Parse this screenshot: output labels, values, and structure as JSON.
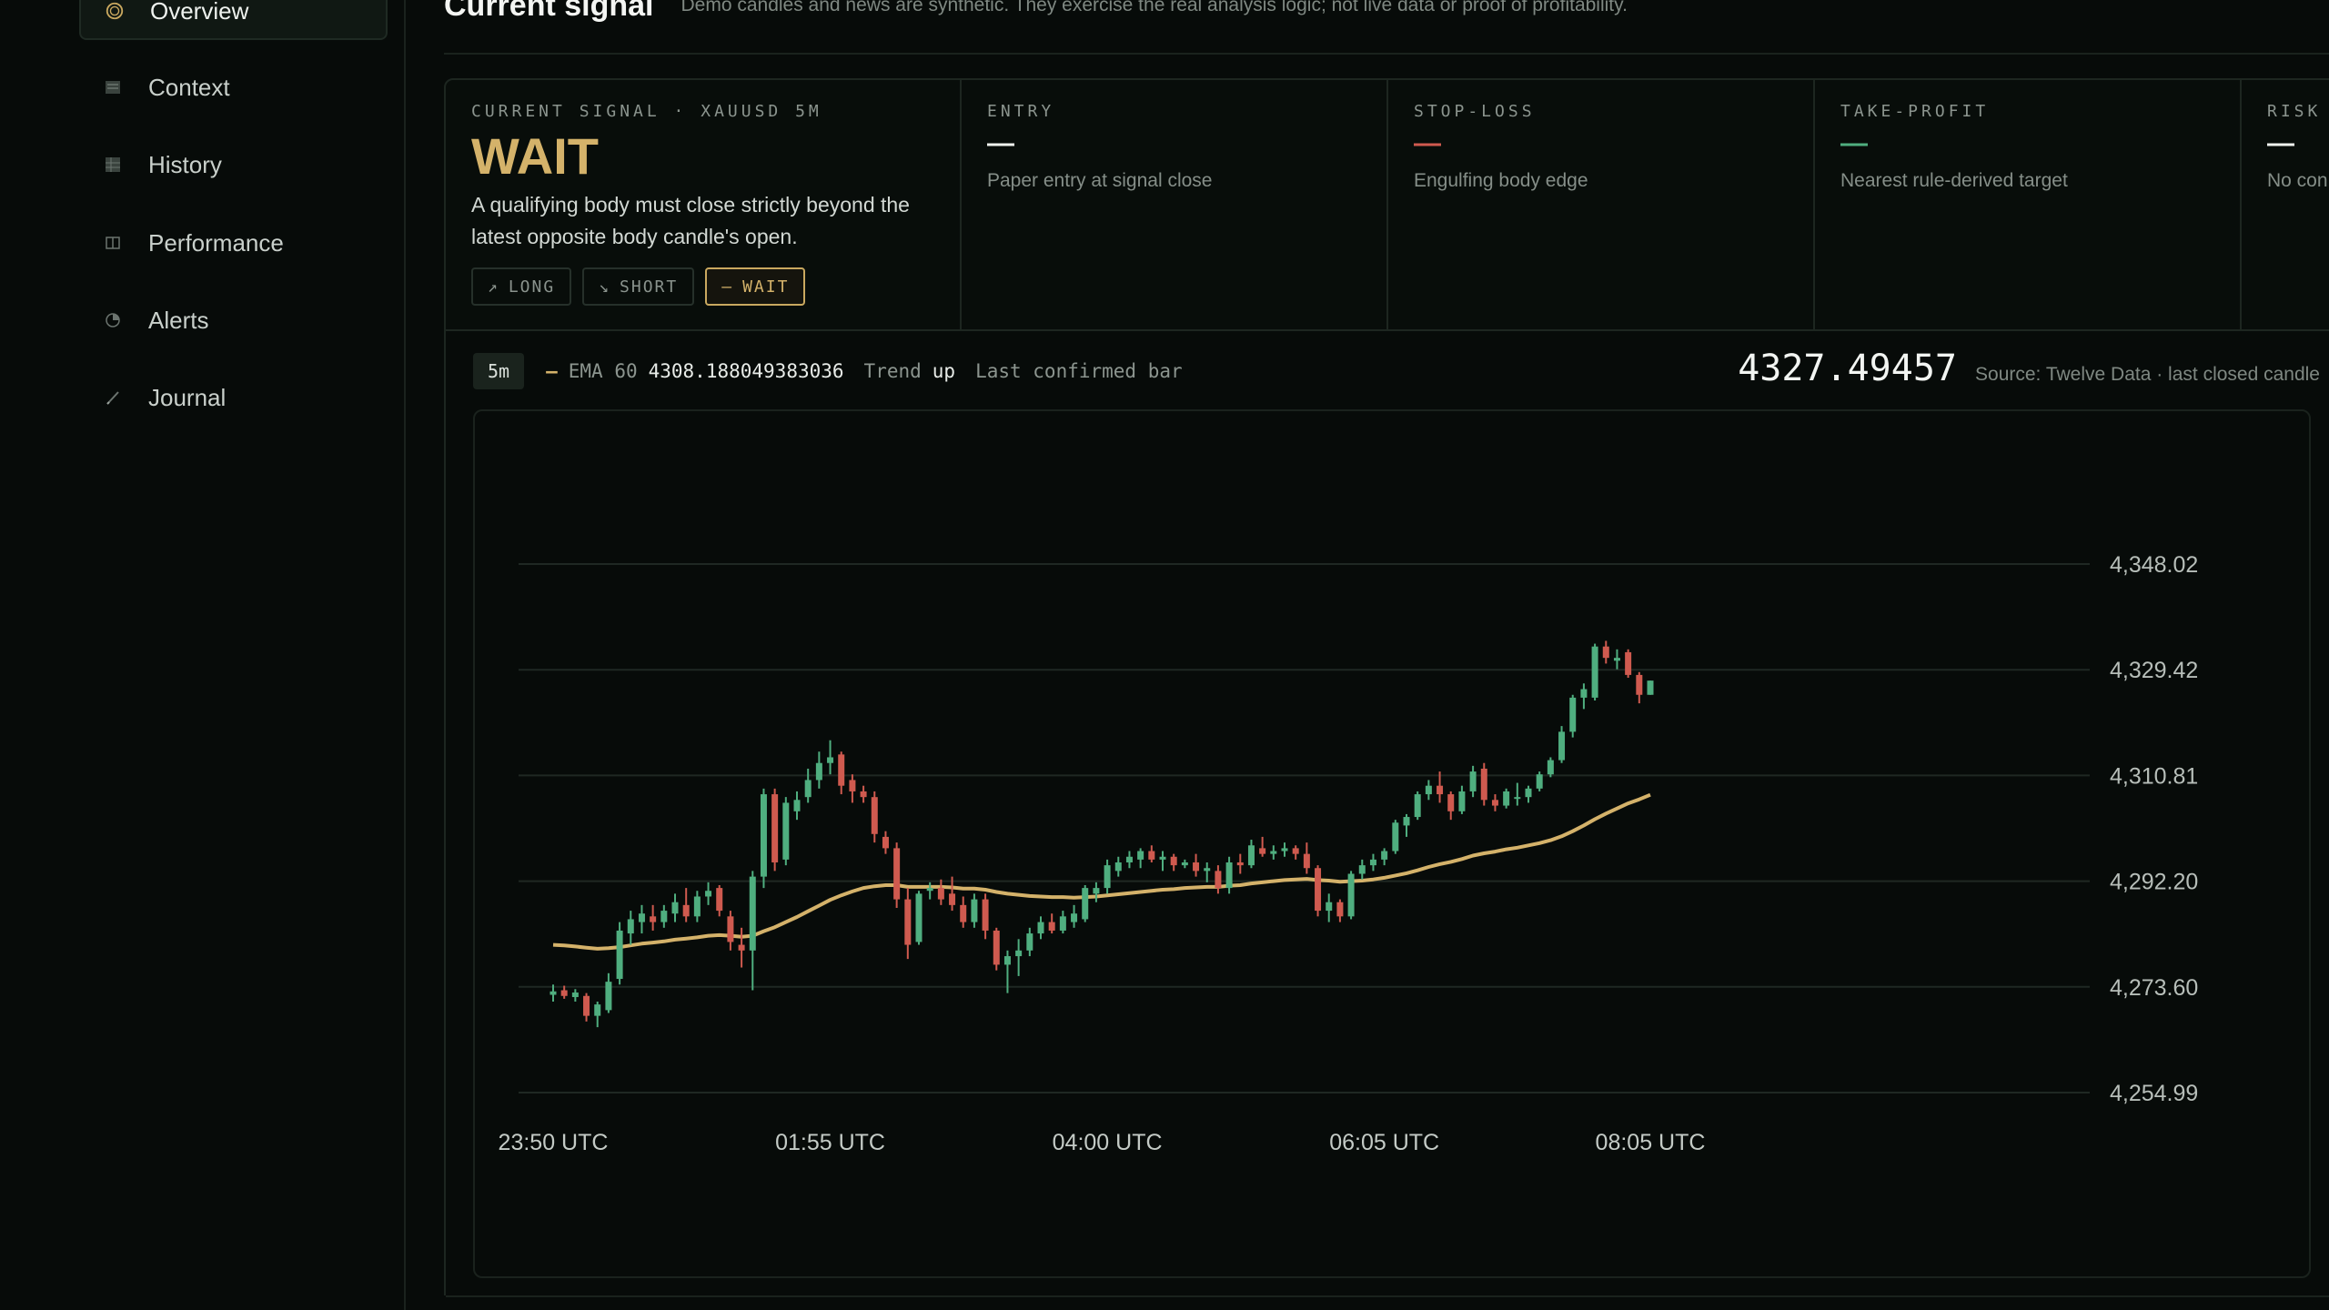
{
  "sidebar": {
    "items": [
      {
        "label": "Overview",
        "icon": "target-icon",
        "active": true
      },
      {
        "label": "Context",
        "icon": "document-icon",
        "active": false
      },
      {
        "label": "History",
        "icon": "grid-icon",
        "active": false
      },
      {
        "label": "Performance",
        "icon": "columns-icon",
        "active": false
      },
      {
        "label": "Alerts",
        "icon": "pie-icon",
        "active": false
      },
      {
        "label": "Journal",
        "icon": "pen-icon",
        "active": false
      }
    ]
  },
  "header": {
    "title": "Current signal",
    "disclaimer": "Demo candles and news are synthetic. They exercise the real analysis logic; not live data or proof of profitability."
  },
  "signal": {
    "label": "CURRENT SIGNAL · XAUUSD 5M",
    "value": "WAIT",
    "description": "A qualifying body must close strictly beyond the latest opposite body candle's open.",
    "buttons": {
      "long": "LONG",
      "short": "SHORT",
      "wait": "WAIT"
    },
    "entry": {
      "label": "ENTRY",
      "value": "—",
      "sub": "Paper entry at signal close"
    },
    "stop_loss": {
      "label": "STOP-LOSS",
      "value": "—",
      "sub": "Engulfing body edge"
    },
    "take_profit": {
      "label": "TAKE-PROFIT",
      "value": "—",
      "sub": "Nearest rule-derived target"
    },
    "risk": {
      "label": "RISK",
      "value": "—",
      "sub": "No con"
    }
  },
  "chart_header": {
    "timeframe": "5m",
    "ema_label": "EMA 60",
    "ema_value": "4308.188049383036",
    "trend_label": "Trend",
    "trend_value": "up",
    "bar_status": "Last confirmed bar",
    "price": "4327.49457",
    "source": "Source: Twelve Data · last closed candle"
  },
  "colors": {
    "up": "#4fae7f",
    "down": "#cf5a4f",
    "ema": "#d4b26a",
    "accent": "#d4b26a"
  },
  "chart_data": {
    "type": "candlestick",
    "y_ticks": [
      "4,348.02",
      "4,329.42",
      "4,310.81",
      "4,292.20",
      "4,273.60",
      "4,254.99"
    ],
    "ylim": [
      4254.99,
      4348.02
    ],
    "x_ticks": [
      "23:50 UTC",
      "01:55 UTC",
      "04:00 UTC",
      "06:05 UTC",
      "08:05 UTC"
    ],
    "x_tick_index": [
      0,
      25,
      50,
      75,
      99
    ],
    "candles": [
      [
        4272.2,
        4274.0,
        4271.0,
        4272.8
      ],
      [
        4273.0,
        4273.8,
        4271.5,
        4272.0
      ],
      [
        4271.8,
        4273.2,
        4271.0,
        4272.6
      ],
      [
        4272.0,
        4272.5,
        4267.5,
        4268.5
      ],
      [
        4268.5,
        4271.0,
        4266.5,
        4270.5
      ],
      [
        4269.5,
        4276.0,
        4269.0,
        4274.5
      ],
      [
        4275.0,
        4285.0,
        4274.0,
        4283.5
      ],
      [
        4283.0,
        4287.0,
        4281.0,
        4285.5
      ],
      [
        4285.0,
        4288.0,
        4283.0,
        4286.5
      ],
      [
        4286.0,
        4288.0,
        4283.5,
        4285.0
      ],
      [
        4285.0,
        4288.0,
        4284.0,
        4287.0
      ],
      [
        4286.5,
        4290.0,
        4285.0,
        4288.5
      ],
      [
        4288.0,
        4291.0,
        4285.0,
        4286.0
      ],
      [
        4286.0,
        4290.5,
        4285.0,
        4289.5
      ],
      [
        4289.5,
        4292.0,
        4288.0,
        4290.5
      ],
      [
        4291.0,
        4291.5,
        4286.0,
        4287.0
      ],
      [
        4286.0,
        4287.0,
        4280.0,
        4281.5
      ],
      [
        4281.0,
        4284.0,
        4277.0,
        4280.0
      ],
      [
        4280.0,
        4294.0,
        4273.0,
        4293.0
      ],
      [
        4293.0,
        4308.5,
        4291.0,
        4307.5
      ],
      [
        4307.5,
        4308.5,
        4294.0,
        4295.5
      ],
      [
        4296.0,
        4307.0,
        4295.0,
        4306.0
      ],
      [
        4304.5,
        4308.0,
        4303.0,
        4306.5
      ],
      [
        4307.0,
        4312.0,
        4306.0,
        4310.0
      ],
      [
        4310.0,
        4315.0,
        4308.5,
        4313.0
      ],
      [
        4313.0,
        4317.0,
        4311.0,
        4314.0
      ],
      [
        4314.5,
        4315.0,
        4307.5,
        4309.0
      ],
      [
        4310.0,
        4311.0,
        4306.0,
        4308.0
      ],
      [
        4308.0,
        4309.0,
        4306.0,
        4307.0
      ],
      [
        4307.0,
        4308.0,
        4299.0,
        4300.5
      ],
      [
        4300.0,
        4301.0,
        4297.0,
        4298.0
      ],
      [
        4298.0,
        4299.0,
        4287.5,
        4289.0
      ],
      [
        4289.0,
        4291.0,
        4278.5,
        4281.0
      ],
      [
        4281.5,
        4290.5,
        4281.0,
        4290.0
      ],
      [
        4290.5,
        4292.0,
        4289.0,
        4291.0
      ],
      [
        4291.0,
        4292.5,
        4288.0,
        4289.0
      ],
      [
        4290.0,
        4293.0,
        4287.0,
        4288.0
      ],
      [
        4288.0,
        4289.5,
        4284.0,
        4285.0
      ],
      [
        4285.0,
        4290.0,
        4284.0,
        4289.0
      ],
      [
        4289.0,
        4290.0,
        4282.0,
        4283.5
      ],
      [
        4283.5,
        4284.0,
        4276.5,
        4277.5
      ],
      [
        4277.5,
        4280.0,
        4272.5,
        4279.0
      ],
      [
        4279.0,
        4282.0,
        4275.5,
        4280.0
      ],
      [
        4280.0,
        4284.0,
        4279.0,
        4283.0
      ],
      [
        4283.0,
        4286.0,
        4282.0,
        4285.0
      ],
      [
        4285.0,
        4286.5,
        4283.0,
        4283.5
      ],
      [
        4283.5,
        4287.0,
        4283.0,
        4286.0
      ],
      [
        4285.0,
        4288.0,
        4284.0,
        4286.5
      ],
      [
        4285.5,
        4291.5,
        4285.0,
        4291.0
      ],
      [
        4290.0,
        4292.0,
        4288.5,
        4291.0
      ],
      [
        4291.0,
        4296.0,
        4290.0,
        4295.0
      ],
      [
        4294.0,
        4296.5,
        4293.0,
        4295.5
      ],
      [
        4295.5,
        4297.5,
        4294.5,
        4296.5
      ],
      [
        4296.0,
        4298.0,
        4294.5,
        4297.5
      ],
      [
        4297.5,
        4298.5,
        4295.5,
        4296.0
      ],
      [
        4296.0,
        4297.5,
        4294.0,
        4296.5
      ],
      [
        4296.5,
        4297.0,
        4294.0,
        4295.0
      ],
      [
        4295.0,
        4296.0,
        4294.5,
        4295.5
      ],
      [
        4295.5,
        4297.0,
        4293.0,
        4294.0
      ],
      [
        4294.0,
        4295.5,
        4292.0,
        4294.5
      ],
      [
        4294.0,
        4295.0,
        4290.0,
        4291.0
      ],
      [
        4291.0,
        4296.5,
        4290.0,
        4295.5
      ],
      [
        4295.5,
        4297.0,
        4293.5,
        4295.0
      ],
      [
        4295.0,
        4299.5,
        4294.5,
        4298.5
      ],
      [
        4298.0,
        4300.0,
        4296.5,
        4297.0
      ],
      [
        4297.0,
        4298.5,
        4296.0,
        4297.5
      ],
      [
        4297.5,
        4299.0,
        4296.5,
        4298.0
      ],
      [
        4298.0,
        4298.5,
        4296.0,
        4297.0
      ],
      [
        4297.0,
        4299.0,
        4293.5,
        4294.5
      ],
      [
        4294.5,
        4295.0,
        4286.0,
        4287.0
      ],
      [
        4287.0,
        4290.0,
        4285.0,
        4288.5
      ],
      [
        4288.5,
        4289.0,
        4285.0,
        4286.0
      ],
      [
        4286.0,
        4294.0,
        4285.5,
        4293.5
      ],
      [
        4293.5,
        4296.0,
        4292.5,
        4295.0
      ],
      [
        4295.0,
        4297.0,
        4294.0,
        4296.0
      ],
      [
        4296.0,
        4298.0,
        4295.0,
        4297.5
      ],
      [
        4297.5,
        4303.0,
        4297.0,
        4302.5
      ],
      [
        4302.0,
        4304.0,
        4300.0,
        4303.5
      ],
      [
        4303.5,
        4308.0,
        4303.0,
        4307.5
      ],
      [
        4307.5,
        4310.0,
        4306.5,
        4309.0
      ],
      [
        4309.0,
        4311.5,
        4306.0,
        4307.5
      ],
      [
        4307.5,
        4308.0,
        4303.0,
        4304.5
      ],
      [
        4304.5,
        4309.0,
        4304.0,
        4308.0
      ],
      [
        4308.0,
        4312.5,
        4307.0,
        4311.5
      ],
      [
        4312.0,
        4313.0,
        4305.5,
        4306.5
      ],
      [
        4306.5,
        4307.5,
        4304.5,
        4305.5
      ],
      [
        4305.5,
        4308.5,
        4305.0,
        4308.0
      ],
      [
        4307.0,
        4309.5,
        4305.5,
        4307.0
      ],
      [
        4307.0,
        4309.0,
        4306.0,
        4308.5
      ],
      [
        4308.5,
        4311.5,
        4308.0,
        4311.0
      ],
      [
        4311.0,
        4314.0,
        4310.5,
        4313.5
      ],
      [
        4313.5,
        4319.5,
        4313.0,
        4318.5
      ],
      [
        4318.5,
        4325.0,
        4317.5,
        4324.5
      ],
      [
        4324.5,
        4327.0,
        4322.5,
        4326.0
      ],
      [
        4324.5,
        4334.0,
        4324.0,
        4333.5
      ],
      [
        4333.5,
        4334.5,
        4330.5,
        4331.5
      ],
      [
        4331.0,
        4333.0,
        4329.5,
        4331.5
      ],
      [
        4332.5,
        4333.0,
        4328.0,
        4328.5
      ],
      [
        4328.5,
        4329.0,
        4323.5,
        4325.0
      ],
      [
        4325.0,
        4327.5,
        4325.0,
        4327.5
      ]
    ],
    "ema": [
      4281.0,
      4280.9,
      4280.7,
      4280.5,
      4280.3,
      4280.4,
      4280.6,
      4280.9,
      4281.2,
      4281.4,
      4281.6,
      4281.9,
      4282.1,
      4282.3,
      4282.6,
      4282.7,
      4282.6,
      4282.4,
      4282.6,
      4283.4,
      4284.1,
      4285.0,
      4285.9,
      4286.9,
      4287.9,
      4288.9,
      4289.7,
      4290.4,
      4291.0,
      4291.3,
      4291.5,
      4291.5,
      4291.2,
      4291.2,
      4291.2,
      4291.2,
      4291.1,
      4290.9,
      4290.9,
      4290.7,
      4290.3,
      4290.0,
      4289.8,
      4289.6,
      4289.5,
      4289.4,
      4289.4,
      4289.3,
      4289.4,
      4289.5,
      4289.7,
      4289.9,
      4290.1,
      4290.3,
      4290.5,
      4290.7,
      4290.8,
      4291.0,
      4291.1,
      4291.2,
      4291.2,
      4291.4,
      4291.5,
      4291.8,
      4292.0,
      4292.2,
      4292.4,
      4292.5,
      4292.6,
      4292.4,
      4292.3,
      4292.1,
      4292.2,
      4292.3,
      4292.5,
      4292.8,
      4293.2,
      4293.6,
      4294.1,
      4294.7,
      4295.2,
      4295.6,
      4296.1,
      4296.7,
      4297.1,
      4297.4,
      4297.8,
      4298.1,
      4298.5,
      4298.9,
      4299.4,
      4300.1,
      4301.0,
      4302.0,
      4303.1,
      4304.1,
      4305.0,
      4305.9,
      4306.6,
      4307.4
    ]
  }
}
